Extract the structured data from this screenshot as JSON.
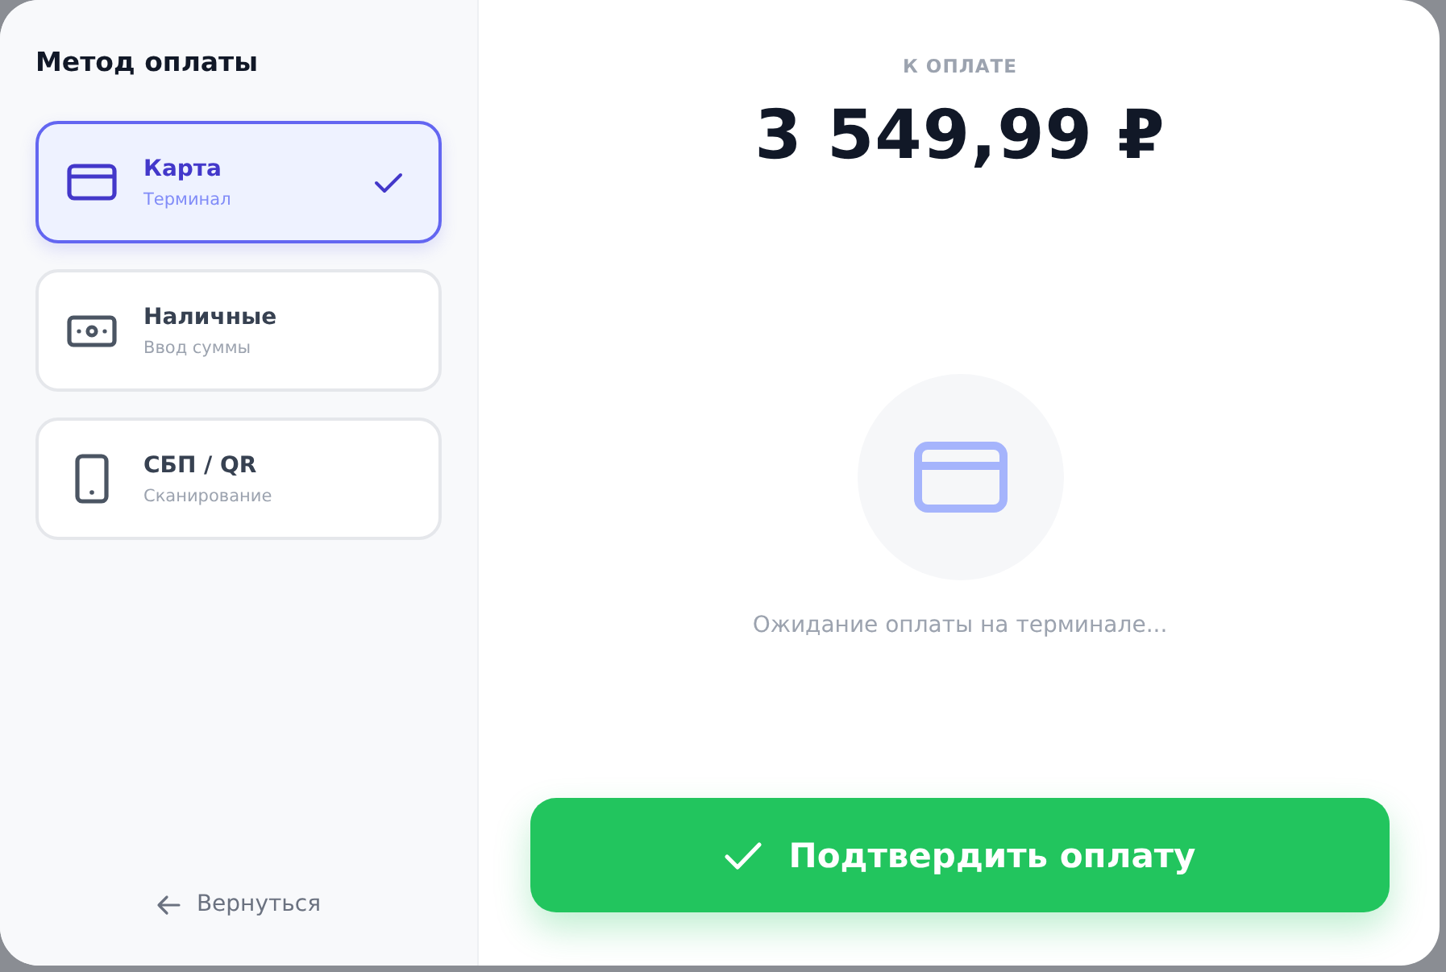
{
  "sidebar": {
    "title": "Метод оплаты",
    "methods": [
      {
        "kind": "card",
        "title": "Карта",
        "subtitle": "Терминал",
        "selected": true
      },
      {
        "kind": "cash",
        "title": "Наличные",
        "subtitle": "Ввод суммы",
        "selected": false
      },
      {
        "kind": "phone",
        "title": "СБП / QR",
        "subtitle": "Сканирование",
        "selected": false
      }
    ],
    "back_link": "Вернуться"
  },
  "payment": {
    "label": "К ОПЛАТЕ",
    "amount": "3 549,99 ₽",
    "status": "Ожидание оплаты на терминале...",
    "confirm_button": "Подтвердить оплату"
  }
}
